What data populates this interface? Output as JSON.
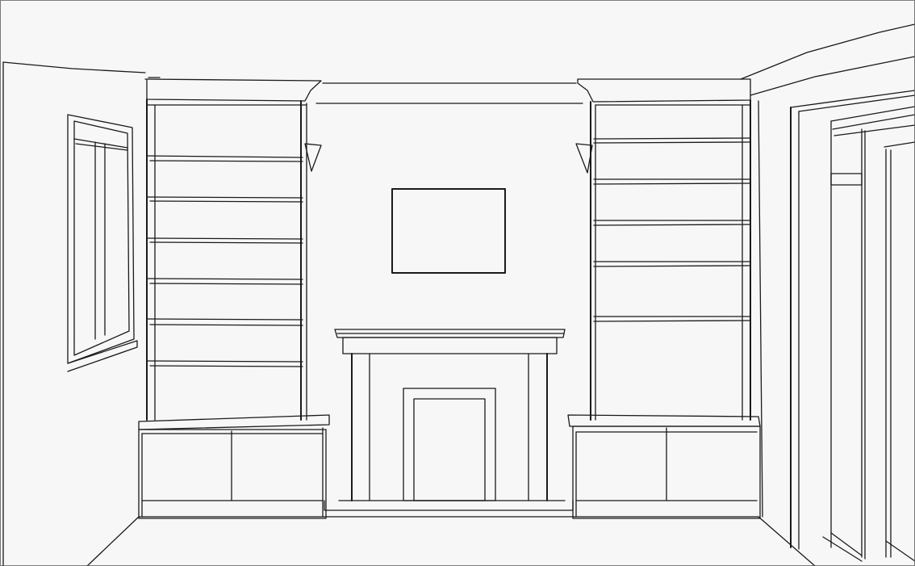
{
  "image": {
    "kind": "line-drawing",
    "subject": "room-interior-sketch",
    "stroke_color": "#1a1a1a",
    "paper_color": "#f7f7f7"
  }
}
